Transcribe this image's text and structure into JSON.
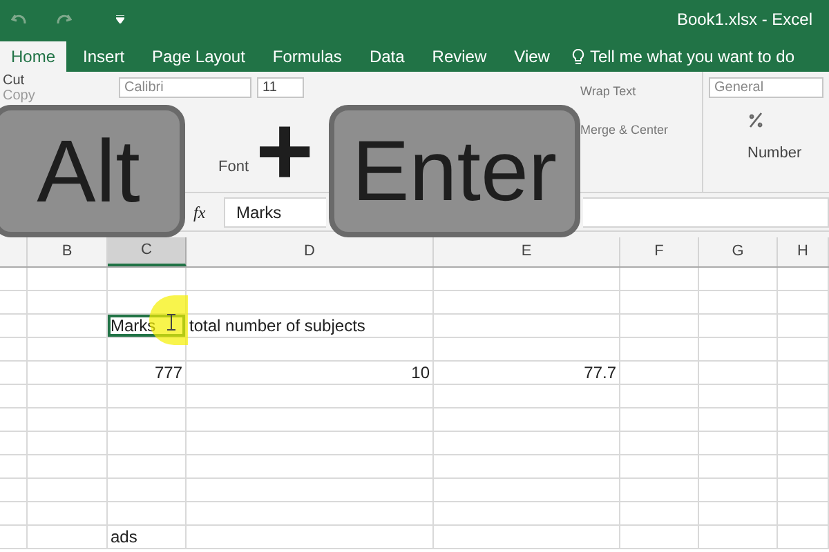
{
  "window": {
    "title": "Book1.xlsx - Excel"
  },
  "tabs": [
    {
      "label": "Home",
      "selected": true
    },
    {
      "label": "Insert",
      "selected": false
    },
    {
      "label": "Page Layout",
      "selected": false
    },
    {
      "label": "Formulas",
      "selected": false
    },
    {
      "label": "Data",
      "selected": false
    },
    {
      "label": "Review",
      "selected": false
    },
    {
      "label": "View",
      "selected": false
    }
  ],
  "tell_me": "Tell me what you want to do",
  "ribbon": {
    "clipboard": [
      "Cut",
      "Copy"
    ],
    "font_name": "Calibri",
    "font_size": "11",
    "font_group": "Font",
    "wrap_text": "Wrap Text",
    "merge": "Merge & Center",
    "number_format": "General",
    "number_group": "Number"
  },
  "formula_bar": {
    "fx": "fx",
    "value": "Marks"
  },
  "keys": {
    "first": "Alt",
    "joiner": "+",
    "second": "Enter"
  },
  "sheet": {
    "columns": [
      {
        "label": "B",
        "selected": false
      },
      {
        "label": "C",
        "selected": true
      },
      {
        "label": "D",
        "selected": false
      },
      {
        "label": "E",
        "selected": false
      },
      {
        "label": "F",
        "selected": false
      },
      {
        "label": "G",
        "selected": false
      },
      {
        "label": "H",
        "selected": false
      }
    ],
    "rows": [
      {
        "kind": "blank"
      },
      {
        "kind": "blank"
      },
      {
        "kind": "filled",
        "cells": {
          "C": {
            "text": "Marks",
            "kind": "text",
            "selected": true
          },
          "D": {
            "text": "total number of subjects",
            "kind": "text",
            "selected": false
          }
        }
      },
      {
        "kind": "blank"
      },
      {
        "kind": "filled",
        "cells": {
          "C": {
            "text": "777",
            "kind": "number",
            "selected": false
          },
          "D": {
            "text": "10",
            "kind": "number",
            "selected": false
          },
          "E": {
            "text": "77.7",
            "kind": "number",
            "selected": false
          }
        }
      },
      {
        "kind": "blank"
      },
      {
        "kind": "blank"
      },
      {
        "kind": "blank"
      },
      {
        "kind": "blank"
      },
      {
        "kind": "blank"
      },
      {
        "kind": "blank"
      },
      {
        "kind": "filled",
        "cells": {
          "C": {
            "text": "ads",
            "kind": "text",
            "selected": false
          }
        }
      }
    ]
  }
}
